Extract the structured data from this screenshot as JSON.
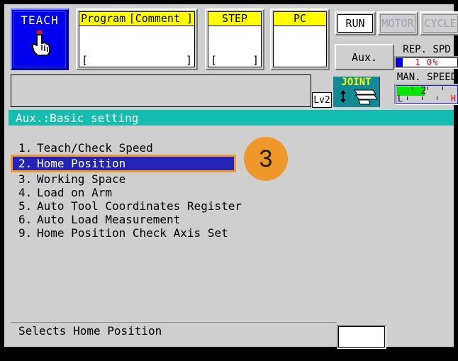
{
  "header": {
    "teach": {
      "label": "TEACH",
      "icon": "hand-pointing-icon"
    },
    "panels": [
      {
        "id": "program",
        "head_left": "Program",
        "head_right": "[Comment  ]",
        "body_left_bracket": "[",
        "body_right_bracket": "]"
      },
      {
        "id": "step",
        "head": "STEP",
        "body_left_bracket": "[",
        "body_right_bracket": "]"
      },
      {
        "id": "pc",
        "head": "PC",
        "body_left_bracket": "",
        "body_right_bracket": ""
      }
    ],
    "status_buttons": [
      {
        "label": "RUN",
        "state": "active"
      },
      {
        "label": "MOTOR",
        "state": "disabled"
      },
      {
        "label": "CYCLE",
        "state": "disabled"
      }
    ],
    "aux_button": "Aux.",
    "rep_speed": {
      "title": "REP. SPD",
      "value": "1 0%",
      "fill_percent": 10,
      "fill_color": "#0000ee",
      "text_color": "#cc0000"
    },
    "man_speed": {
      "title": "MAN. SPEED",
      "value": "2",
      "fill_percent": 45,
      "fill_color": "#00e800",
      "low_label": "L",
      "high_label": "H",
      "high_color": "#dd0000"
    },
    "message_strip": "",
    "level_badge": "Lv2",
    "joint": {
      "label": "JOINT",
      "background": "#118a96",
      "label_color": "#ffff00"
    }
  },
  "title_bar": {
    "text": "Aux.:Basic setting",
    "background": "#13bdaf",
    "text_color": "#ffffff"
  },
  "menu": {
    "selected_index": 1,
    "selected_background": "#2323b8",
    "selected_border": "#f0972a",
    "items": [
      {
        "number": "1.",
        "label": "Teach/Check Speed"
      },
      {
        "number": "2.",
        "label": "Home Position"
      },
      {
        "number": "3.",
        "label": "Working Space"
      },
      {
        "number": "4.",
        "label": "Load on Arm"
      },
      {
        "number": "5.",
        "label": "Auto Tool Coordinates Register"
      },
      {
        "number": "6.",
        "label": "Auto Load Measurement"
      },
      {
        "number": "9.",
        "label": "Home Position Check Axis Set"
      }
    ]
  },
  "annotation": {
    "step_badge": "3",
    "badge_color": "#f0972a"
  },
  "footer": {
    "status_text": "Selects Home Position",
    "input_value": ""
  }
}
